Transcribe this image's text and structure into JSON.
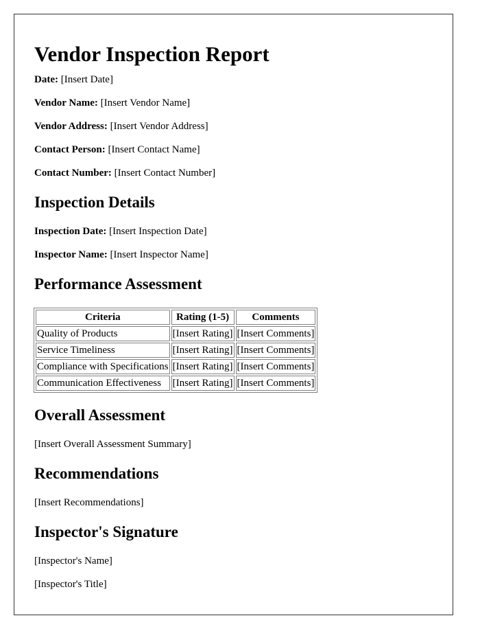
{
  "title": "Vendor Inspection Report",
  "header_fields": [
    {
      "label": "Date:",
      "value": "[Insert Date]"
    },
    {
      "label": "Vendor Name:",
      "value": "[Insert Vendor Name]"
    },
    {
      "label": "Vendor Address:",
      "value": "[Insert Vendor Address]"
    },
    {
      "label": "Contact Person:",
      "value": "[Insert Contact Name]"
    },
    {
      "label": "Contact Number:",
      "value": "[Insert Contact Number]"
    }
  ],
  "inspection_details": {
    "heading": "Inspection Details",
    "fields": [
      {
        "label": "Inspection Date:",
        "value": "[Insert Inspection Date]"
      },
      {
        "label": "Inspector Name:",
        "value": "[Insert Inspector Name]"
      }
    ]
  },
  "performance": {
    "heading": "Performance Assessment",
    "columns": [
      "Criteria",
      "Rating (1-5)",
      "Comments"
    ],
    "rows": [
      [
        "Quality of Products",
        "[Insert Rating]",
        "[Insert Comments]"
      ],
      [
        "Service Timeliness",
        "[Insert Rating]",
        "[Insert Comments]"
      ],
      [
        "Compliance with Specifications",
        "[Insert Rating]",
        "[Insert Comments]"
      ],
      [
        "Communication Effectiveness",
        "[Insert Rating]",
        "[Insert Comments]"
      ]
    ]
  },
  "overall": {
    "heading": "Overall Assessment",
    "text": "[Insert Overall Assessment Summary]"
  },
  "recommendations": {
    "heading": "Recommendations",
    "text": "[Insert Recommendations]"
  },
  "signature": {
    "heading": "Inspector's Signature",
    "name": "[Inspector's Name]",
    "title": "[Inspector's Title]"
  }
}
